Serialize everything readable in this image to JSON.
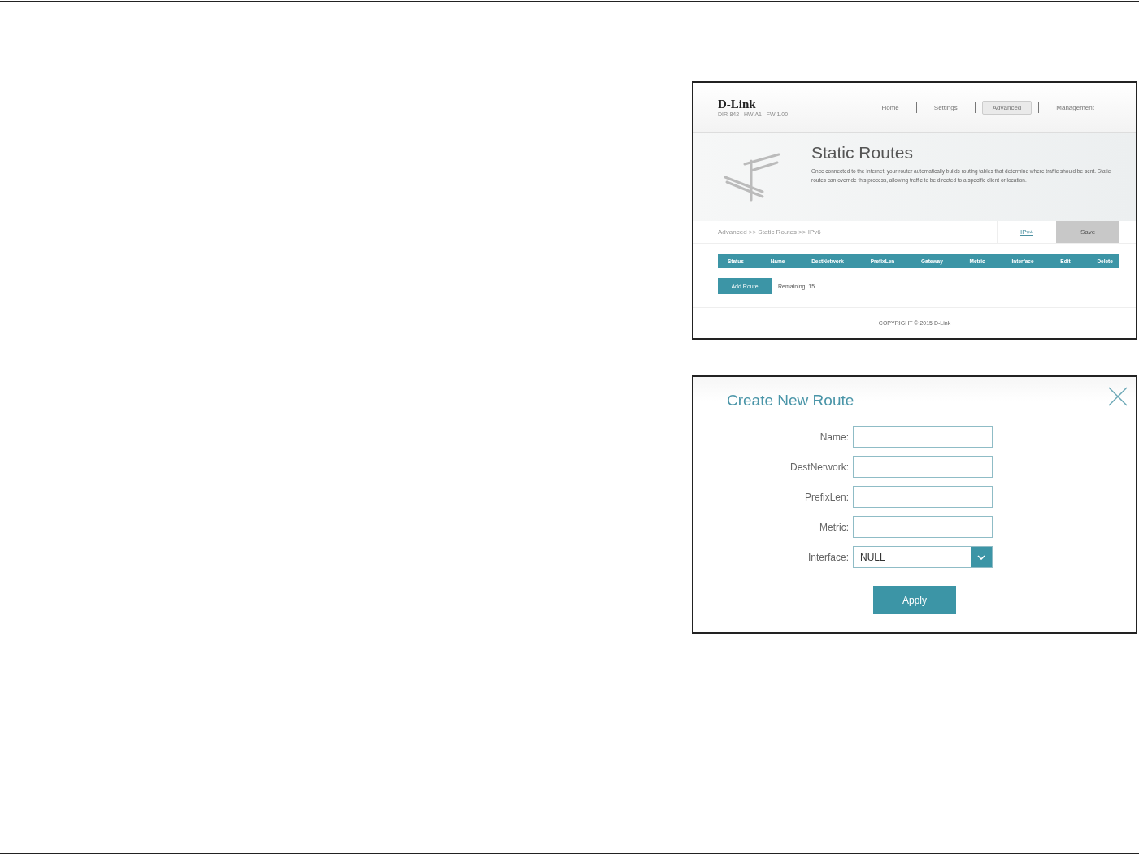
{
  "router_page": {
    "logo": "D-Link",
    "model_info": "DIR-842   HW:A1   FW:1.00",
    "nav": [
      {
        "label": "Home",
        "selected": false
      },
      {
        "label": "Settings",
        "selected": false
      },
      {
        "label": "Advanced",
        "selected": true
      },
      {
        "label": "Management",
        "selected": false
      }
    ],
    "title": "Static Routes",
    "description": "Once connected to the Internet, your router automatically builds routing tables that determine where traffic should be sent. Static routes can override this process, allowing traffic to be directed to a specific client or location.",
    "breadcrumb": "Advanced >> Static Routes >> IPv6",
    "ipv4_link": "IPv4",
    "save_button": {
      "label": "Save",
      "disabled": true
    },
    "table": {
      "columns": [
        "Status",
        "Name",
        "DestNetwork",
        "PrefixLen",
        "Gateway",
        "Metric",
        "Interface",
        "Edit",
        "Delete"
      ]
    },
    "add_button": "Add Route",
    "remaining": "Remaining: 15",
    "copyright": "COPYRIGHT © 2015 D-Link"
  },
  "dialog": {
    "title": "Create New Route",
    "fields": [
      {
        "label": "Name:",
        "kind": "text"
      },
      {
        "label": "DestNetwork:",
        "kind": "text"
      },
      {
        "label": "PrefixLen:",
        "kind": "text"
      },
      {
        "label": "Metric:",
        "kind": "text"
      },
      {
        "label": "Interface:",
        "kind": "select",
        "value": "NULL"
      }
    ],
    "apply_button": "Apply"
  }
}
